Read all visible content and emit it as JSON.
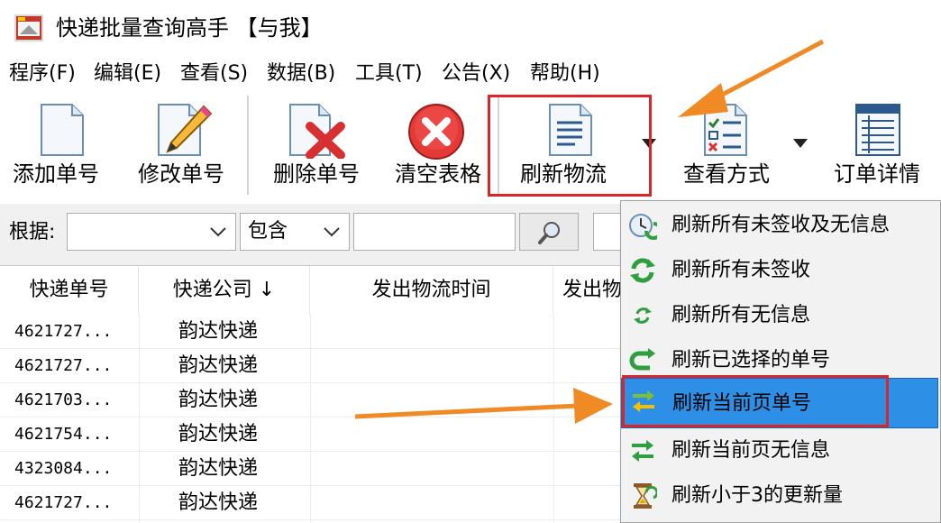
{
  "window": {
    "title": "快递批量查询高手 【与我】",
    "accent": "#2e8fe6",
    "highlight_color": "#d9262a",
    "arrow_color": "#f08a24"
  },
  "menu": [
    {
      "label": "程序(F)"
    },
    {
      "label": "编辑(E)"
    },
    {
      "label": "查看(S)"
    },
    {
      "label": "数据(B)"
    },
    {
      "label": "工具(T)"
    },
    {
      "label": "公告(X)"
    },
    {
      "label": "帮助(H)"
    }
  ],
  "toolbar": {
    "add": "添加单号",
    "edit": "修改单号",
    "delete": "删除单号",
    "clear": "清空表格",
    "refresh": "刷新物流",
    "view_mode": "查看方式",
    "detail": "订单详情"
  },
  "filter": {
    "label": "根据:",
    "field_value": "",
    "condition_value": "包含",
    "search_value": ""
  },
  "table": {
    "headers": [
      "快递单号",
      "快递公司 ↓",
      "发出物流时间",
      "发出物"
    ],
    "rows": [
      {
        "no": "4621727...",
        "company": "韵达快递"
      },
      {
        "no": "4621727...",
        "company": "韵达快递"
      },
      {
        "no": "4621703...",
        "company": "韵达快递"
      },
      {
        "no": "4621754...",
        "company": "韵达快递"
      },
      {
        "no": "4323084...",
        "company": "韵达快递"
      },
      {
        "no": "4621727...",
        "company": "韵达快递"
      }
    ]
  },
  "refresh_menu": {
    "items": [
      {
        "label": "刷新所有未签收及无信息",
        "icon": "refresh-clock-icon"
      },
      {
        "label": "刷新所有未签收",
        "icon": "refresh-green-icon"
      },
      {
        "label": "刷新所有无信息",
        "icon": "refresh-small-icon"
      },
      {
        "label": "刷新已选择的单号",
        "icon": "refresh-selected-icon"
      },
      {
        "label": "刷新当前页单号",
        "icon": "refresh-page-icon",
        "selected": true
      },
      {
        "label": "刷新当前页无信息",
        "icon": "refresh-page-noinfo-icon"
      },
      {
        "label": "刷新小于3的更新量",
        "icon": "hourglass-icon"
      }
    ]
  }
}
